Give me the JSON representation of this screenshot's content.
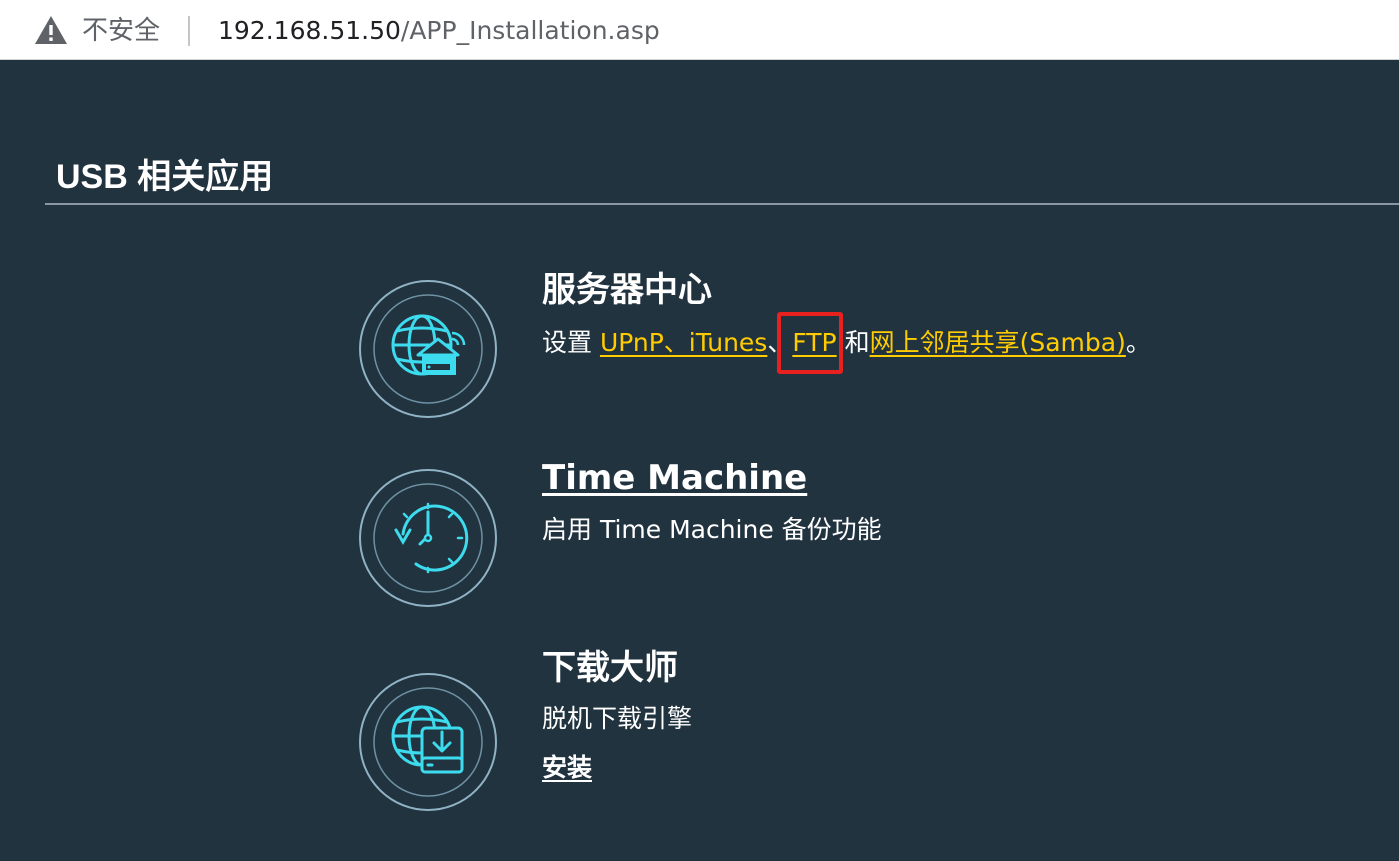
{
  "browser": {
    "security_label": "不安全",
    "url_host": "192.168.51.50",
    "url_path": "/APP_Installation.asp"
  },
  "page": {
    "section_title": "USB 相关应用"
  },
  "apps": {
    "server_center": {
      "name": "服务器中心",
      "desc_prefix": "设置 ",
      "link_upnp_itunes": "UPnP、iTunes",
      "sep": "、",
      "link_ftp": "FTP",
      "mid": " 和",
      "link_samba": "网上邻居共享(Samba)",
      "desc_suffix": "。"
    },
    "time_machine": {
      "name": "Time Machine",
      "desc": "启用 Time Machine 备份功能"
    },
    "download_master": {
      "name": "下载大师",
      "desc": "脱机下载引擎",
      "install_label": "安装"
    }
  },
  "colors": {
    "background": "#223340",
    "link": "#ffcc00",
    "icon_accent": "#3ddbee",
    "highlight": "#e8211f"
  },
  "icons": {
    "security": "warning-icon",
    "server_center": "globe-house-router-icon",
    "time_machine": "clock-history-icon",
    "download_master": "globe-download-drive-icon"
  }
}
